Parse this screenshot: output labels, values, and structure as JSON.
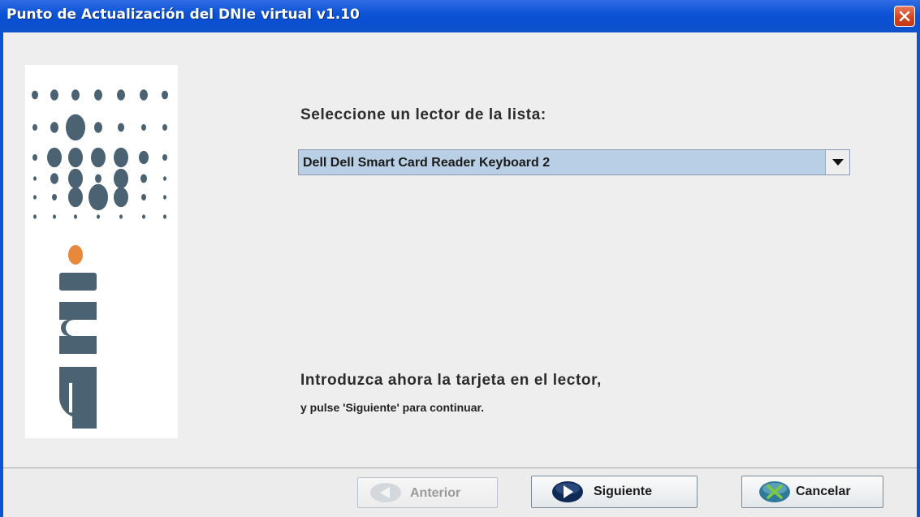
{
  "window": {
    "title": "Punto de Actualización del DNIe virtual v1.10"
  },
  "logo": {
    "text": "dni",
    "accent_color": "#e8883a",
    "dot_color": "#4a6272"
  },
  "main": {
    "heading": "Seleccione un lector de la lista:",
    "reader_select": {
      "selected": "Dell Dell Smart Card Reader Keyboard 2"
    },
    "instruction_line1": "Introduzca ahora la tarjeta en el lector,",
    "instruction_line2": "y pulse 'Siguiente' para continuar."
  },
  "footer": {
    "prev_label": "Anterior",
    "next_label": "Siguiente",
    "cancel_label": "Cancelar"
  },
  "icons": {
    "close": "close-icon",
    "prev": "arrow-left-icon",
    "next": "arrow-right-icon",
    "cancel": "x-circle-icon",
    "dropdown": "chevron-down-icon"
  }
}
